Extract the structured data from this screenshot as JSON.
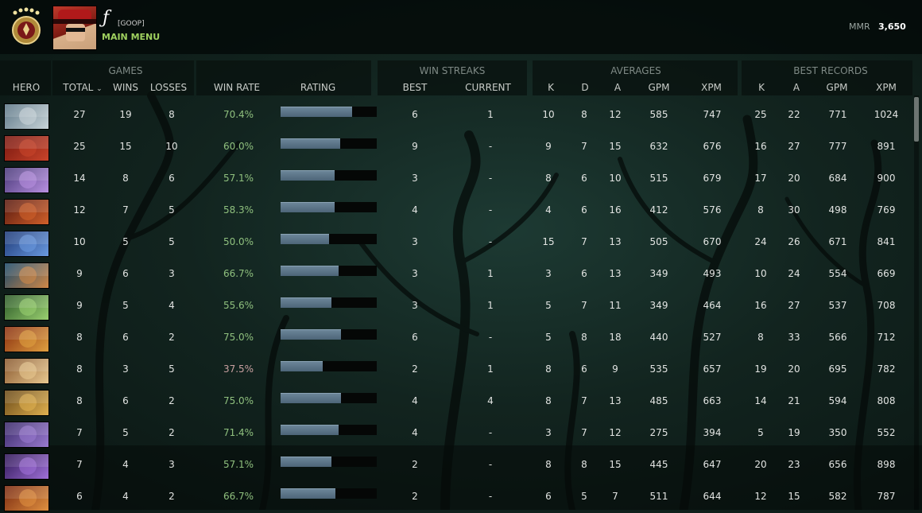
{
  "profile": {
    "username": "ƒ",
    "tag": "[GOOP]",
    "main_menu_label": "MAIN MENU",
    "mmr_label": "MMR",
    "mmr_value": "3,650"
  },
  "header": {
    "groups": {
      "games": "GAMES",
      "win_streaks": "WIN STREAKS",
      "averages": "AVERAGES",
      "best_records": "BEST RECORDS"
    },
    "columns": {
      "hero": "HERO",
      "total": "TOTAL",
      "sort_indicator": "⌄",
      "wins": "WINS",
      "losses": "LOSSES",
      "win_rate": "WIN RATE",
      "rating": "RATING",
      "best": "BEST",
      "current": "CURRENT",
      "avg_k": "K",
      "avg_d": "D",
      "avg_a": "A",
      "avg_gpm": "GPM",
      "avg_xpm": "XPM",
      "best_k": "K",
      "best_a": "A",
      "best_gpm": "GPM",
      "best_xpm": "XPM"
    }
  },
  "rows": [
    {
      "colors": [
        "#5e7888",
        "#c9d4d8"
      ],
      "total": "27",
      "wins": "19",
      "losses": "8",
      "win_rate": "70.4%",
      "rating": 0.74,
      "best": "6",
      "current": "1",
      "k": "10",
      "d": "8",
      "a": "12",
      "gpm": "585",
      "xpm": "747",
      "bk": "25",
      "ba": "22",
      "bgpm": "771",
      "bxpm": "1024"
    },
    {
      "colors": [
        "#7a1810",
        "#c8442a"
      ],
      "total": "25",
      "wins": "15",
      "losses": "10",
      "win_rate": "60.0%",
      "rating": 0.62,
      "best": "9",
      "current": "-",
      "k": "9",
      "d": "7",
      "a": "15",
      "gpm": "632",
      "xpm": "676",
      "bk": "16",
      "ba": "27",
      "bgpm": "777",
      "bxpm": "891"
    },
    {
      "colors": [
        "#4a3a7a",
        "#b890e0"
      ],
      "total": "14",
      "wins": "8",
      "losses": "6",
      "win_rate": "57.1%",
      "rating": 0.56,
      "best": "3",
      "current": "-",
      "k": "8",
      "d": "6",
      "a": "10",
      "gpm": "515",
      "xpm": "679",
      "bk": "17",
      "ba": "20",
      "bgpm": "684",
      "bxpm": "900"
    },
    {
      "colors": [
        "#5a1a10",
        "#d0602a"
      ],
      "total": "12",
      "wins": "7",
      "losses": "5",
      "win_rate": "58.3%",
      "rating": 0.56,
      "best": "4",
      "current": "-",
      "k": "4",
      "d": "6",
      "a": "16",
      "gpm": "412",
      "xpm": "576",
      "bk": "8",
      "ba": "30",
      "bgpm": "498",
      "bxpm": "769"
    },
    {
      "colors": [
        "#1e3a78",
        "#6a9ae0"
      ],
      "total": "10",
      "wins": "5",
      "losses": "5",
      "win_rate": "50.0%",
      "rating": 0.5,
      "best": "3",
      "current": "-",
      "k": "15",
      "d": "7",
      "a": "13",
      "gpm": "505",
      "xpm": "670",
      "bk": "24",
      "ba": "26",
      "bgpm": "671",
      "bxpm": "841"
    },
    {
      "colors": [
        "#1c4a6a",
        "#d08848"
      ],
      "total": "9",
      "wins": "6",
      "losses": "3",
      "win_rate": "66.7%",
      "rating": 0.6,
      "best": "3",
      "current": "1",
      "k": "3",
      "d": "6",
      "a": "13",
      "gpm": "349",
      "xpm": "493",
      "bk": "10",
      "ba": "24",
      "bgpm": "554",
      "bxpm": "669"
    },
    {
      "colors": [
        "#2c5a28",
        "#9ad070"
      ],
      "total": "9",
      "wins": "5",
      "losses": "4",
      "win_rate": "55.6%",
      "rating": 0.53,
      "best": "3",
      "current": "1",
      "k": "5",
      "d": "7",
      "a": "11",
      "gpm": "349",
      "xpm": "464",
      "bk": "16",
      "ba": "27",
      "bgpm": "537",
      "bxpm": "708"
    },
    {
      "colors": [
        "#8a3010",
        "#e0a040"
      ],
      "total": "8",
      "wins": "6",
      "losses": "2",
      "win_rate": "75.0%",
      "rating": 0.63,
      "best": "6",
      "current": "-",
      "k": "5",
      "d": "8",
      "a": "18",
      "gpm": "440",
      "xpm": "527",
      "bk": "8",
      "ba": "33",
      "bgpm": "566",
      "bxpm": "712"
    },
    {
      "colors": [
        "#8a5a30",
        "#e8c890"
      ],
      "total": "8",
      "wins": "3",
      "losses": "5",
      "win_rate": "37.5%",
      "rating": 0.44,
      "best": "2",
      "current": "1",
      "k": "8",
      "d": "6",
      "a": "9",
      "gpm": "535",
      "xpm": "657",
      "bk": "19",
      "ba": "20",
      "bgpm": "695",
      "bxpm": "782"
    },
    {
      "colors": [
        "#6a4a18",
        "#e0b050"
      ],
      "total": "8",
      "wins": "6",
      "losses": "2",
      "win_rate": "75.0%",
      "rating": 0.63,
      "best": "4",
      "current": "4",
      "k": "8",
      "d": "7",
      "a": "13",
      "gpm": "485",
      "xpm": "663",
      "bk": "14",
      "ba": "21",
      "bgpm": "594",
      "bxpm": "808"
    },
    {
      "colors": [
        "#3a2a6a",
        "#9a7ad0"
      ],
      "total": "7",
      "wins": "5",
      "losses": "2",
      "win_rate": "71.4%",
      "rating": 0.6,
      "best": "4",
      "current": "-",
      "k": "3",
      "d": "7",
      "a": "12",
      "gpm": "275",
      "xpm": "394",
      "bk": "5",
      "ba": "19",
      "bgpm": "350",
      "bxpm": "552"
    },
    {
      "colors": [
        "#301858",
        "#a070d8"
      ],
      "total": "7",
      "wins": "4",
      "losses": "3",
      "win_rate": "57.1%",
      "rating": 0.53,
      "best": "2",
      "current": "-",
      "k": "8",
      "d": "8",
      "a": "15",
      "gpm": "445",
      "xpm": "647",
      "bk": "20",
      "ba": "23",
      "bgpm": "656",
      "bxpm": "898"
    },
    {
      "colors": [
        "#7a2a10",
        "#e09040"
      ],
      "total": "6",
      "wins": "4",
      "losses": "2",
      "win_rate": "66.7%",
      "rating": 0.57,
      "best": "2",
      "current": "-",
      "k": "6",
      "d": "5",
      "a": "7",
      "gpm": "511",
      "xpm": "644",
      "bk": "12",
      "ba": "15",
      "bgpm": "582",
      "bxpm": "787"
    }
  ]
}
